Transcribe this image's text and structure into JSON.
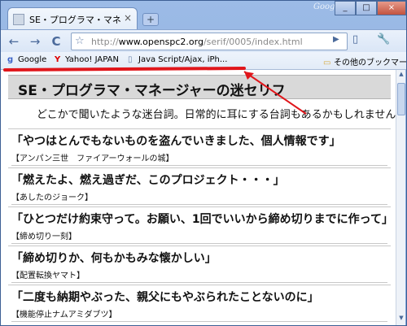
{
  "browser": {
    "tab_title": "SE・プログラマ・マネージャーの...",
    "tab_close": "×",
    "new_tab": "+",
    "brand": "Google",
    "window_buttons": {
      "minimize": "_",
      "maximize": "□",
      "close": "×"
    }
  },
  "toolbar": {
    "back_icon": "←",
    "forward_icon": "→",
    "reload_icon": "C",
    "url_scheme": "http://",
    "url_host": "www.openspc2.org",
    "url_path": "/serif/0005/index.html",
    "go_icon": "▶",
    "page_icon": "▯",
    "tools_icon": "🔧"
  },
  "bookmarks": {
    "google": "Google",
    "yahoo": "Yahoo! JAPAN",
    "js": "Java Script/Ajax, iPh...",
    "other": "その他のブックマーク"
  },
  "page": {
    "title": "SE・プログラマ・マネージャーの迷セリフ",
    "subtitle": "どこかで聞いたような迷台詞。日常的に耳にする台詞もあるかもしれません。",
    "entries": [
      {
        "quote": "「やつはとんでもないものを盗んでいきました、個人情報です」",
        "source": "【アンパン三世　ファイアーウォールの城】"
      },
      {
        "quote": "「燃えたよ、燃え過ぎだ、このプロジェクト・・・」",
        "source": "【あしたのジョーク】"
      },
      {
        "quote": "「ひとつだけ約束守って。お願い、1回でいいから締め切りまでに作って」",
        "source": "【締め切り一刻】"
      },
      {
        "quote": "「締め切りか、何もかもみな懐かしい」",
        "source": "【配置転換ヤマト】"
      },
      {
        "quote": "「二度も納期やぶった、親父にもやぶられたことないのに」",
        "source": "【機能停止ナムアミダブツ】"
      }
    ]
  },
  "colors": {
    "annotation_line": "#e0161b",
    "header_bg": "#d9d9d9",
    "frame": "#7fa3d9"
  }
}
